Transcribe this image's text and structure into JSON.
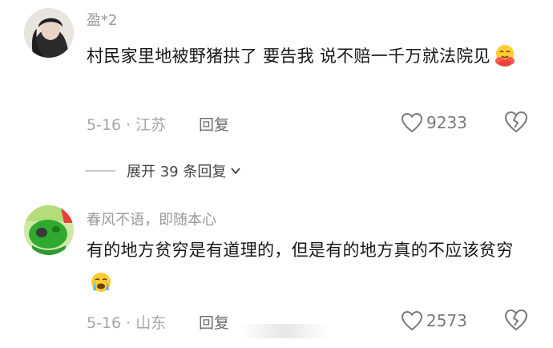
{
  "comments": [
    {
      "username": "盈*2",
      "text": "村民家里地被野猪拱了 要告我 说不赔一千万就法院见",
      "emoji": "hug-face-emoji",
      "date": "5-16",
      "location": "江苏",
      "reply_label": "回复",
      "likes": "9233"
    },
    {
      "username": "春风不语，即随本心",
      "text": "有的地方贫穷是有道理的，但是有的地方真的不应该贫穷",
      "emoji": "crying-face-emoji",
      "date": "5-16",
      "location": "山东",
      "reply_label": "回复",
      "likes": "2573"
    }
  ],
  "expand_replies": "展开 39 条回复",
  "meta_separator": "·",
  "colors": {
    "text_primary": "#161616",
    "text_secondary": "#a6a6a6",
    "icon": "#7a7a7a"
  }
}
